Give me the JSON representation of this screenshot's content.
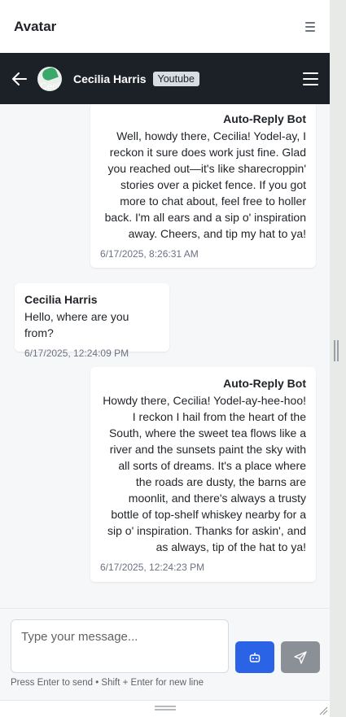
{
  "app": {
    "title": "Avatar"
  },
  "chat_header": {
    "contact_name": "Cecilia Harris",
    "platform": "Youtube",
    "avatar_alt": "Ceci"
  },
  "messages": [
    {
      "sender": "Auto-Reply Bot",
      "type": "bot",
      "text": "Well, howdy there, Cecilia! Yodel-ay, I reckon it sure does work just fine. Glad you reached out—it's like sharecroppin' stories over a picket fence. If you got more to chat about, feel free to holler back. I'm all ears and a sip o' inspiration away. Cheers, and tip my hat to ya!",
      "time": "6/17/2025, 8:26:31 AM"
    },
    {
      "sender": "Cecilia Harris",
      "type": "user",
      "text": "Hello, where are you from?",
      "time": "6/17/2025, 12:24:09 PM"
    },
    {
      "sender": "Auto-Reply Bot",
      "type": "bot",
      "text": "Howdy there, Cecilia! Yodel-ay-hee-hoo! I reckon I hail from the heart of the South, where the sweet tea flows like a river and the sunsets paint the sky with all sorts of dreams. It's a place where the roads are dusty, the barns are moonlit, and there's always a trusty bottle of top-shelf whiskey nearby for a sip o' inspiration. Thanks for askin', and as always, tip of the hat to ya!",
      "time": "6/17/2025, 12:24:23 PM"
    }
  ],
  "composer": {
    "placeholder": "Type your message...",
    "hint": "Press Enter to send • Shift + Enter for new line"
  },
  "icons": {
    "menu": "menu-lines-icon",
    "back": "arrow-left-icon",
    "hamburger": "hamburger-icon",
    "bot": "robot-icon",
    "send": "paper-plane-icon"
  },
  "colors": {
    "header_bg": "#1c2128",
    "bot_button": "#2b63e6",
    "send_button": "#8b9096",
    "badge_bg": "#d9dce0"
  }
}
